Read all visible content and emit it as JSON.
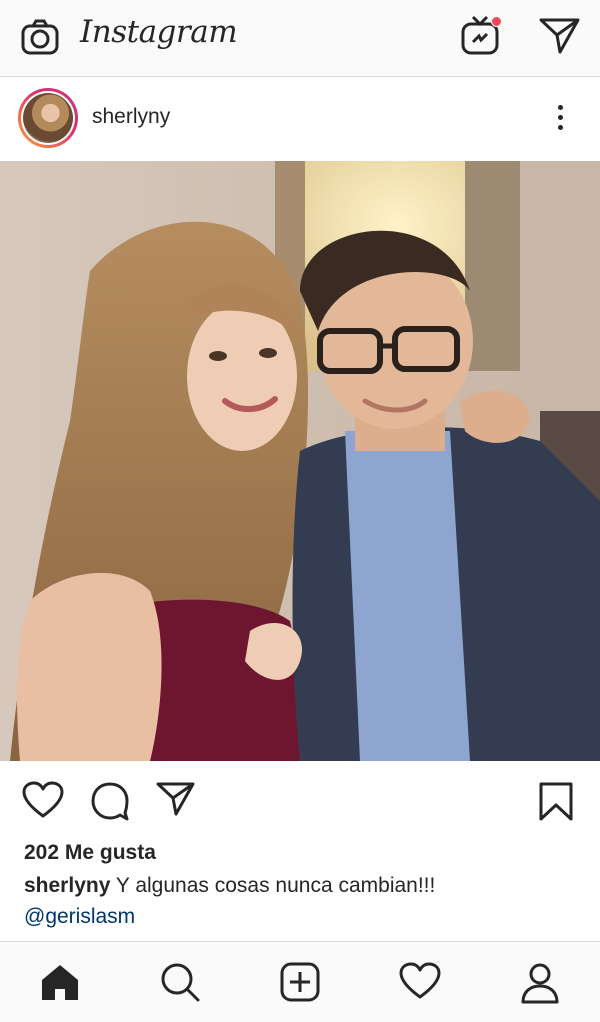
{
  "app": {
    "logo": "Instagram"
  },
  "topbar": {
    "icons": [
      "camera-icon",
      "igtv-icon",
      "direct-message-icon"
    ],
    "notification_dot_color": "#ed4956"
  },
  "post": {
    "username": "sherlyny",
    "likes": "202 Me gusta",
    "caption_user": "sherlyny",
    "caption_text": "Y algunas cosas nunca cambian!!!",
    "mention": "@gerislasm",
    "mention_color": "#003569"
  },
  "actions": {
    "icons": [
      "heart-icon",
      "comment-icon",
      "share-icon",
      "bookmark-icon"
    ]
  },
  "bottom_nav": {
    "icons": [
      "home-icon",
      "search-icon",
      "add-post-icon",
      "activity-heart-icon",
      "profile-icon"
    ]
  }
}
